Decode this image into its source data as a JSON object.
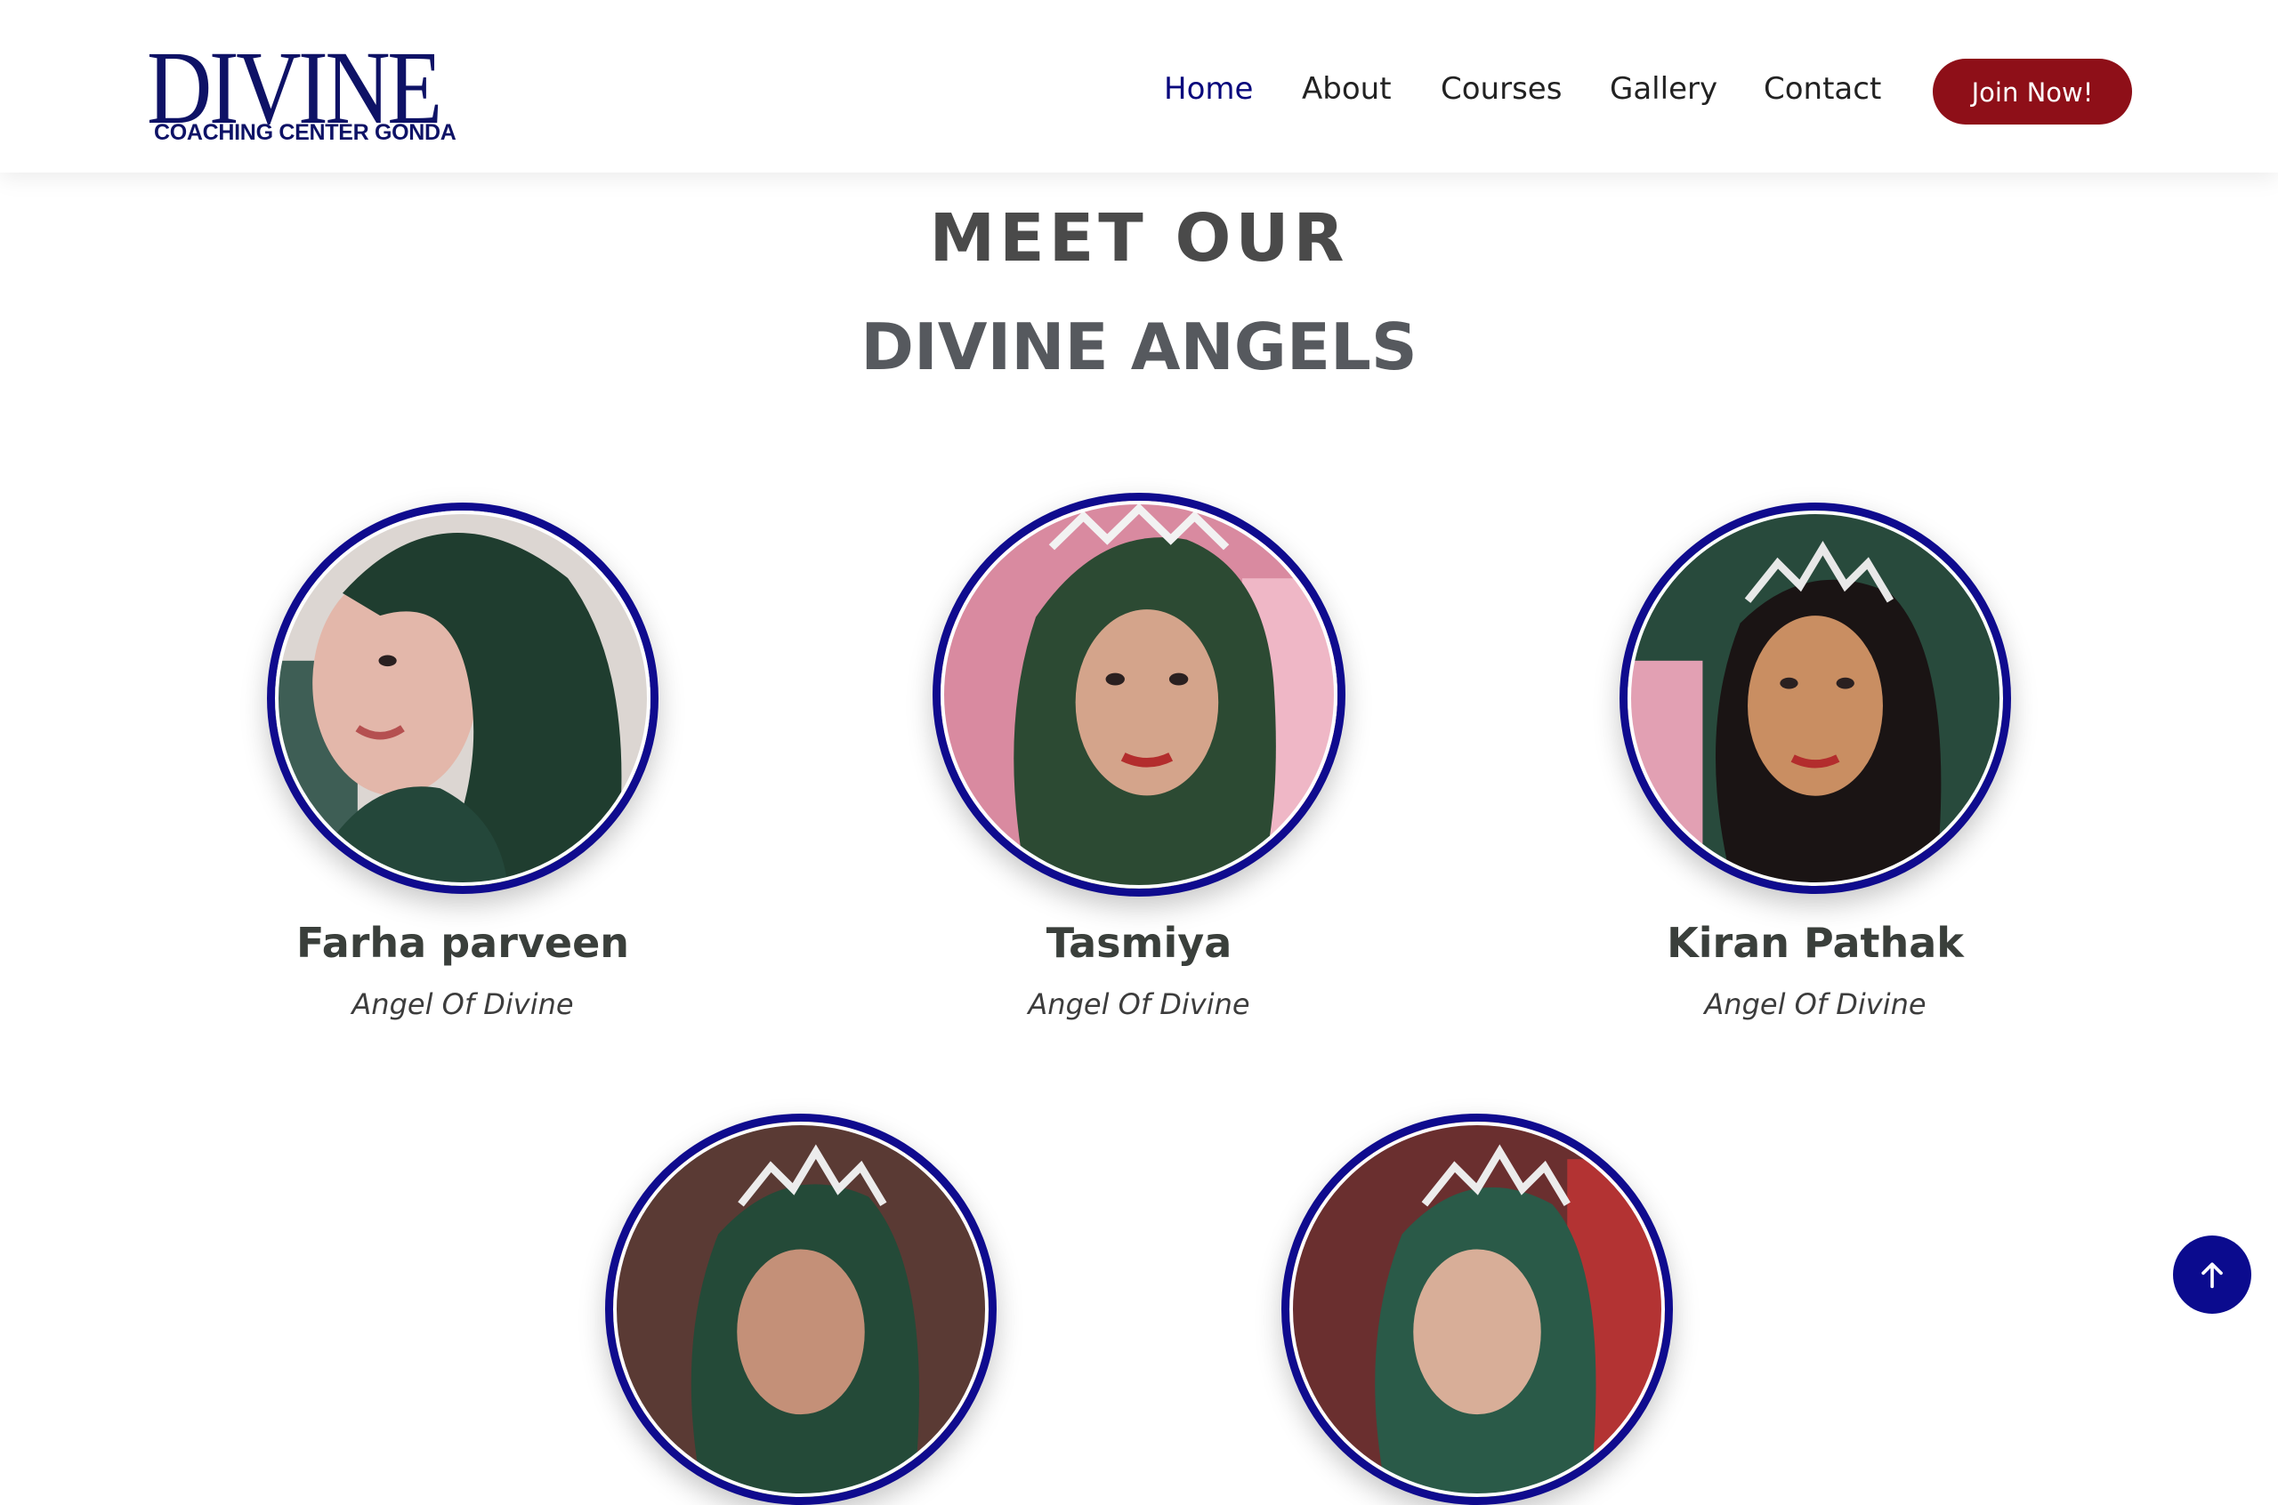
{
  "header": {
    "logo_main": "DIVINE",
    "logo_sub": "COACHING CENTER GONDA",
    "nav": [
      {
        "label": "Home",
        "active": true
      },
      {
        "label": "About",
        "active": false
      },
      {
        "label": "Courses",
        "active": false
      },
      {
        "label": "Gallery",
        "active": false
      },
      {
        "label": "Contact",
        "active": false
      }
    ],
    "join_label": "Join Now!"
  },
  "section": {
    "title_line1": "MEET OUR",
    "title_line2": "DIVINE ANGELS"
  },
  "team": [
    {
      "name": "Farha parveen",
      "role": "Angel Of Divine",
      "photo": "hijab-green"
    },
    {
      "name": "Tasmiya",
      "role": "Angel Of Divine",
      "photo": "hijab-green-tiara"
    },
    {
      "name": "Kiran Pathak",
      "role": "Angel Of Divine",
      "photo": "tiara-dark-hair"
    },
    {
      "name": "",
      "role": "",
      "photo": "hijab-green-tiara"
    },
    {
      "name": "",
      "role": "",
      "photo": "hijab-green-tiara"
    }
  ],
  "colors": {
    "brand_navy": "#0e1266",
    "accent_blue": "#0f0b8e",
    "button_red": "#8e0f18",
    "active_link": "#08077c"
  },
  "icons": {
    "scroll_top": "arrow-up-icon"
  }
}
